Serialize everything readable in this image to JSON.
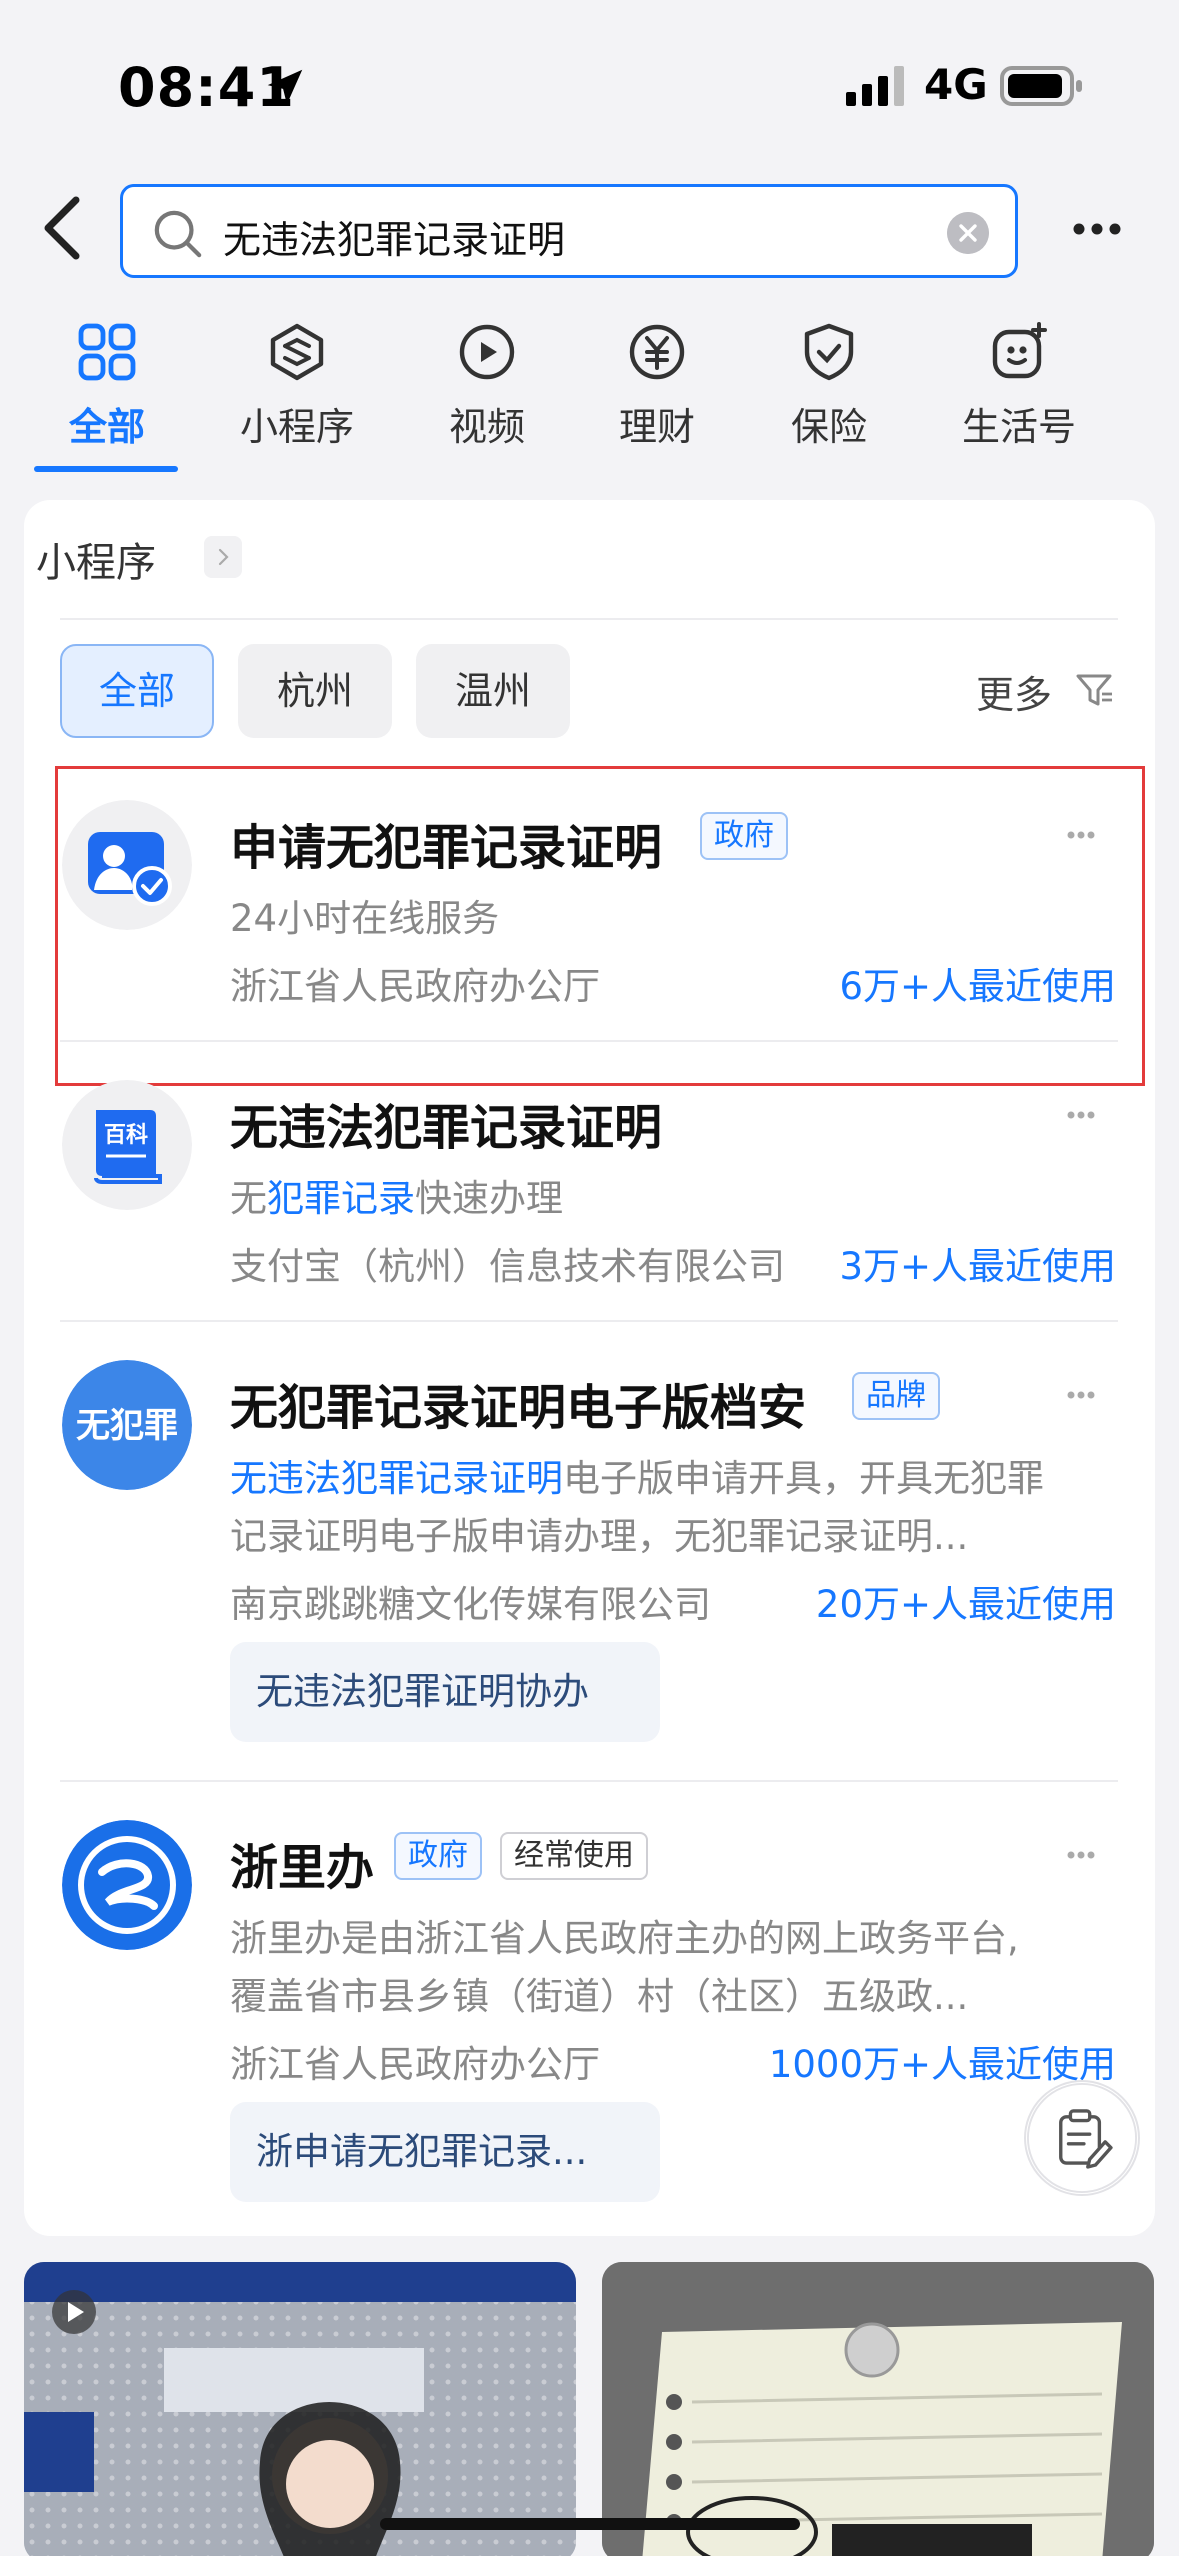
{
  "status_bar": {
    "time": "08:41",
    "network": "4G"
  },
  "search": {
    "query": "无违法犯罪记录证明"
  },
  "tabs": [
    {
      "label": "全部",
      "icon": "grid-icon",
      "active": true
    },
    {
      "label": "小程序",
      "icon": "mini-program-icon"
    },
    {
      "label": "视频",
      "icon": "play-icon"
    },
    {
      "label": "理财",
      "icon": "yen-icon"
    },
    {
      "label": "保险",
      "icon": "shield-check-icon"
    },
    {
      "label": "生活号",
      "icon": "life-account-icon"
    }
  ],
  "section": {
    "title": "小程序",
    "filters": [
      "全部",
      "杭州",
      "温州"
    ],
    "more_label": "更多"
  },
  "results": [
    {
      "title": "申请无犯罪记录证明",
      "badges": [
        "政府"
      ],
      "desc": "24小时在线服务",
      "org": "浙江省人民政府办公厅",
      "users": "6万+人最近使用"
    },
    {
      "title": "无违法犯罪记录证明",
      "desc_prefix": "无",
      "desc_highlight": "犯罪记录",
      "desc_suffix": "快速办理",
      "logo_text": "百科",
      "org": "支付宝（杭州）信息技术有限公司",
      "users": "3万+人最近使用"
    },
    {
      "title": "无犯罪记录证明电子版档安",
      "badges": [
        "品牌"
      ],
      "logo_text": "无犯罪",
      "desc_highlight": "无违法犯罪记录证明",
      "desc_line1_rest": "电子版申请开具，开具无犯罪",
      "desc_line2": "记录证明电子版申请办理，无犯罪记录证明...",
      "org": "南京跳跳糖文化传媒有限公司",
      "users": "20万+人最近使用",
      "service": "无违法犯罪证明协办"
    },
    {
      "title": "浙里办",
      "badges": [
        "政府",
        "经常使用"
      ],
      "desc_line1": "浙里办是由浙江省人民政府主办的网上政务平台,",
      "desc_line2": "覆盖省市县乡镇（街道）村（社区）五级政...",
      "org": "浙江省人民政府办公厅",
      "users": "1000万+人最近使用",
      "service": "浙申请无犯罪记录..."
    }
  ],
  "colors": {
    "accent": "#1677ff",
    "highlight_box": "#e33b3b"
  }
}
